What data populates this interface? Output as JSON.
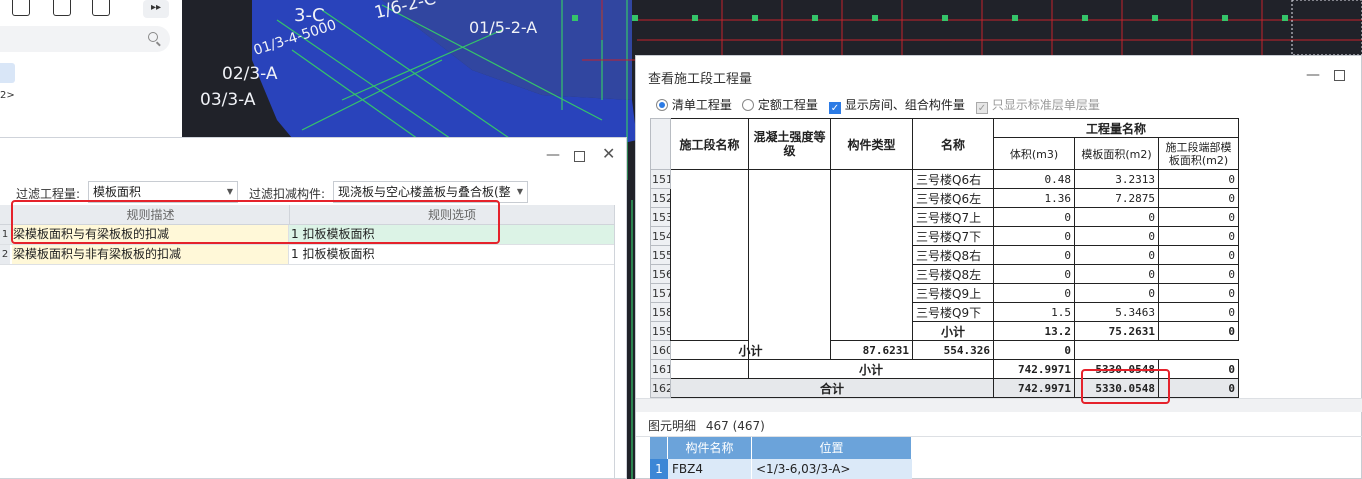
{
  "toolbar": {
    "icons": [
      "delete-icon",
      "copy-icon",
      "paste-icon"
    ],
    "expand_glyph": "▸▸",
    "arrow_glyph": "2>"
  },
  "cad": {
    "labels": [
      "3-C",
      "1/6-2-C",
      "01/3-4-5000",
      "01/5-2-A",
      "02/3-A",
      "03/3-A"
    ]
  },
  "rule_dialog": {
    "filter_qty_label": "过滤工程量:",
    "filter_qty_value": "模板面积",
    "filter_comp_label": "过滤扣减构件:",
    "filter_comp_value": "现浇板与空心楼盖板与叠合板(整",
    "col_desc": "规则描述",
    "col_option": "规则选项",
    "rows": [
      {
        "num": "1",
        "desc": "梁模板面积与有梁板板的扣减",
        "option": "1 扣板模板面积"
      },
      {
        "num": "2",
        "desc": "梁模板面积与非有梁板板的扣减",
        "option": "1 扣板模板面积"
      }
    ]
  },
  "qty_dialog": {
    "title": "查看施工段工程量",
    "options": [
      {
        "label": "清单工程量",
        "type": "radio",
        "checked": true
      },
      {
        "label": "定额工程量",
        "type": "radio",
        "checked": false
      },
      {
        "label": "显示房间、组合构件量",
        "type": "checkbox",
        "checked": true
      },
      {
        "label": "只显示标准层单层量",
        "type": "checkbox",
        "checked": true,
        "disabled": true
      }
    ],
    "headers": {
      "segment": "施工段名称",
      "concrete": "混凝土强度等级",
      "comp_type": "构件类型",
      "name": "名称",
      "qty_group": "工程量名称",
      "volume": "体积(m3)",
      "formwork": "模板面积(m2)",
      "end_formwork": "施工段端部模板面积(m2)"
    },
    "rows": [
      {
        "n": "151",
        "name": "三号楼Q6右",
        "vol": "0.48",
        "form": "3.2313",
        "end": "0"
      },
      {
        "n": "152",
        "name": "三号楼Q6左",
        "vol": "1.36",
        "form": "7.2875",
        "end": "0"
      },
      {
        "n": "153",
        "name": "三号楼Q7上",
        "vol": "0",
        "form": "0",
        "end": "0"
      },
      {
        "n": "154",
        "name": "三号楼Q7下",
        "vol": "0",
        "form": "0",
        "end": "0"
      },
      {
        "n": "155",
        "name": "三号楼Q8右",
        "vol": "0",
        "form": "0",
        "end": "0"
      },
      {
        "n": "156",
        "name": "三号楼Q8左",
        "vol": "0",
        "form": "0",
        "end": "0"
      },
      {
        "n": "157",
        "name": "三号楼Q9上",
        "vol": "0",
        "form": "0",
        "end": "0"
      },
      {
        "n": "158",
        "name": "三号楼Q9下",
        "vol": "1.5",
        "form": "5.3463",
        "end": "0"
      }
    ],
    "subtotals": [
      {
        "n": "159",
        "label": "小计",
        "vol": "13.2",
        "form": "75.2631",
        "end": "0"
      },
      {
        "n": "160",
        "label": "小计",
        "vol": "87.6231",
        "form": "554.326",
        "end": "0"
      },
      {
        "n": "161",
        "label": "小计",
        "vol": "742.9971",
        "form": "5330.0548",
        "end": "0"
      }
    ],
    "total": {
      "n": "162",
      "label": "合计",
      "vol": "742.9971",
      "form": "5330.0548",
      "end": "0"
    },
    "detail_label": "图元明细",
    "detail_count": "467 (467)",
    "detail_headers": {
      "name": "构件名称",
      "position": "位置"
    },
    "detail_rows": [
      {
        "n": "1",
        "name": "FBZ4",
        "position": "<1/3-6,03/3-A>"
      }
    ]
  },
  "colors": {
    "highlight_red": "#e5222b",
    "accent_blue": "#2c7be5",
    "cad_blue": "#2a47c8",
    "cad_green": "#35c46a"
  }
}
